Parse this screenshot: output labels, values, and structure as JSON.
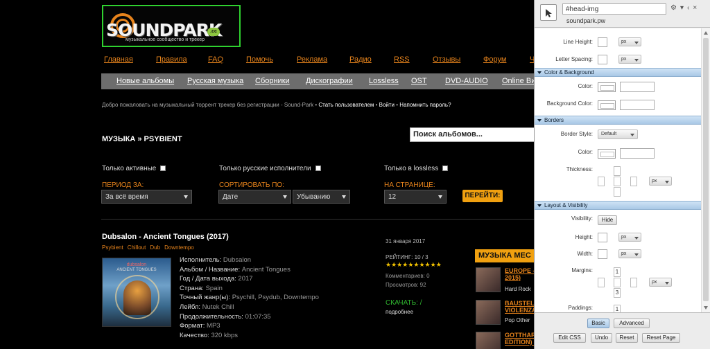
{
  "site": {
    "logo": {
      "name": "SOUNDPARK",
      "cc": ".cc",
      "tagline": "музыкальное сообщество и трекер"
    },
    "topnav": [
      "Главная",
      "Правила",
      "FAQ",
      "Помочь",
      "Реклама",
      "Радио",
      "RSS",
      "Отзывы",
      "Форум",
      "Ч"
    ],
    "catnav": [
      "Новые альбомы",
      "Русская музыка",
      "Сборники",
      "Дискографии",
      "Lossless",
      "OST",
      "DVD-AUDIO",
      "Online Ви"
    ],
    "welcome": {
      "text": "Добро пожаловать на музыкальный торрент трекер без регистрации - Sound-Park",
      "register": "Стать пользователем",
      "login": "Войти",
      "remind": "Напомнить пароль?",
      "sep": "•"
    },
    "breadcrumb": "МУЗЫКА » PSYBIENT",
    "search_placeholder": "Поиск альбомов...",
    "filters": {
      "only_active": "Только активные",
      "only_russian": "Только русские исполнители",
      "only_lossless": "Только в lossless",
      "period_label": "ПЕРИОД ЗА:",
      "period_value": "За всё время",
      "sort_label": "СОРТИРОВАТЬ ПО:",
      "sort_value": "Дате",
      "order_value": "Убыванию",
      "per_page_label": "НА СТРАНИЦЕ:",
      "per_page_value": "12",
      "go_button": "ПЕРЕЙТИ:"
    },
    "album": {
      "title": "Dubsalon - Ancient Tongues (2017)",
      "tags": [
        "Psybient",
        "Chillout",
        "Dub",
        "Downtempo"
      ],
      "cover": {
        "artist": "dubsalon",
        "album": "ANCIENT TONGUES"
      },
      "details": [
        {
          "k": "Исполнитель:",
          "v": "Dubsalon"
        },
        {
          "k": "Альбом / Название:",
          "v": "Ancient Tongues"
        },
        {
          "k": "Год / Дата выхода:",
          "v": "2017"
        },
        {
          "k": "Страна:",
          "v": "Spain"
        },
        {
          "k": "Точный жанр(ы):",
          "v": "Psychill, Psydub, Downtempo"
        },
        {
          "k": "Лейбл:",
          "v": "Nutek Chill"
        },
        {
          "k": "Продолжительность:",
          "v": "01:07:35"
        },
        {
          "k": "Формат:",
          "v": "MP3"
        },
        {
          "k": "Качество:",
          "v": "320 kbps"
        }
      ],
      "date": "31 января 2017",
      "rating": "РЕЙТИНГ: 10 / 3",
      "stars": 10,
      "comments": "Комментариев: 0",
      "views": "Просмотров: 92",
      "download": "СКАЧАТЬ: /",
      "more": "подробнее"
    },
    "sidebar": {
      "header": "МУЗЫКА МЕС",
      "items": [
        {
          "title1": "EUROPE -",
          "title2": "2015)",
          "genre": "Hard Rock"
        },
        {
          "title1": "BAUSTEL",
          "title2": "VIOLENZA",
          "genre": "Pop  Other"
        },
        {
          "title1": "GOTTHAR",
          "title2": "EDITION) (",
          "genre": ""
        }
      ]
    }
  },
  "editor": {
    "selector": "#head-img",
    "domain": "soundpark.pw",
    "header_icons": [
      "⚙",
      "▾",
      "‹",
      "×"
    ],
    "line_height_label": "Line Height:",
    "letter_spacing_label": "Letter Spacing:",
    "unit_px": "px",
    "section_color": "Color & Background",
    "color_label": "Color:",
    "bg_color_label": "Background Color:",
    "section_borders": "Borders",
    "border_style_label": "Border Style:",
    "border_style_value": "Default",
    "border_color_label": "Color:",
    "thickness_label": "Thickness:",
    "section_layout": "Layout & Visibility",
    "visibility_label": "Visibility:",
    "hide_button": "Hide",
    "height_label": "Height:",
    "width_label": "Width:",
    "margins_label": "Margins:",
    "margin_values": [
      "1",
      "3"
    ],
    "paddings_label": "Paddings:",
    "padding_value": "1",
    "mode_basic": "Basic",
    "mode_advanced": "Advanced",
    "btn_edit_css": "Edit CSS",
    "btn_undo": "Undo",
    "btn_reset": "Reset",
    "btn_reset_page": "Reset Page"
  }
}
